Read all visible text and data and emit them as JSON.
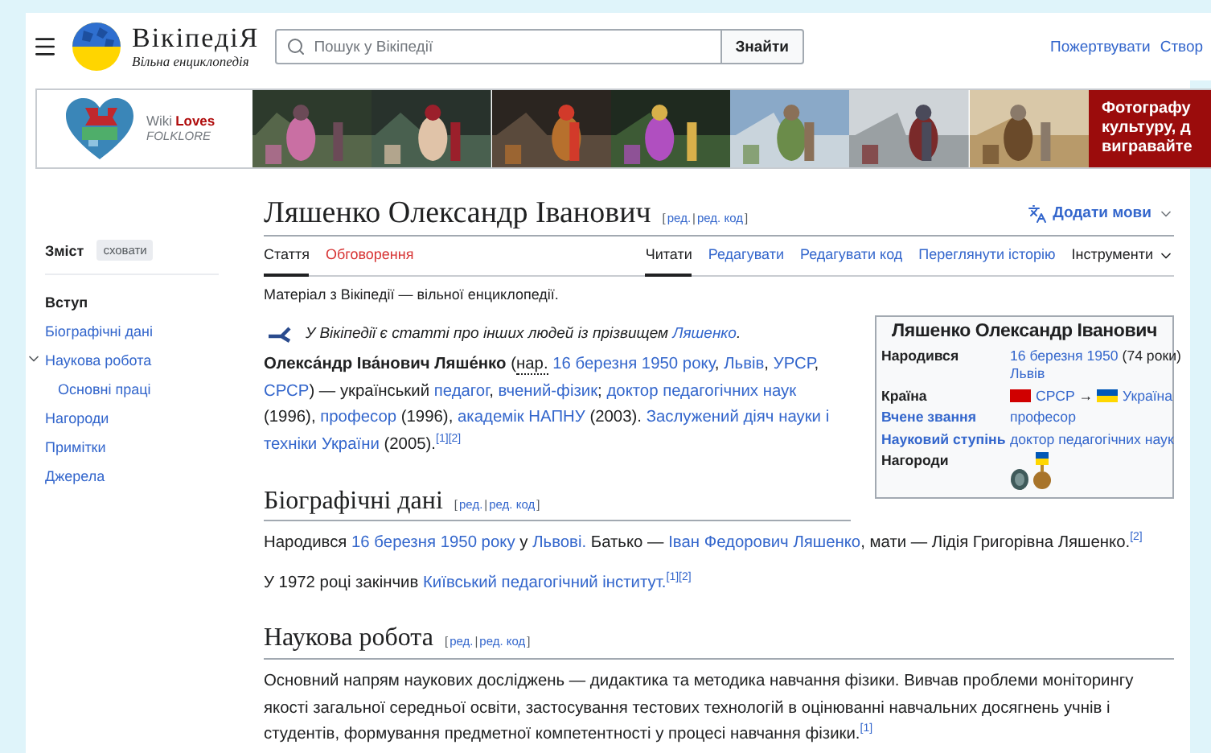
{
  "header": {
    "logo_title": "ВікіпедіЯ",
    "logo_subtitle": "Вільна енциклопедія",
    "search": {
      "placeholder": "Пошук у Вікіпедії",
      "button": "Знайти"
    },
    "links": [
      "Пожертвувати",
      "Створ"
    ]
  },
  "banner": {
    "logo_words": [
      "Wiki",
      "Loves"
    ],
    "logo_sub": "FOLKLORE",
    "photos": [
      {
        "kind": "picture"
      },
      {
        "kind": "picture"
      },
      {
        "kind": "picture"
      },
      {
        "kind": "picture"
      },
      {
        "kind": "picture"
      },
      {
        "kind": "picture"
      },
      {
        "kind": "picture"
      }
    ],
    "promo_lines": [
      "Фотографу",
      "культуру, д",
      "вигравайте"
    ]
  },
  "sidebar": {
    "title": "Зміст",
    "hide_button": "сховати",
    "items": [
      {
        "label": "Вступ",
        "selected": true
      },
      {
        "label": "Біографічні дані",
        "selected": false
      },
      {
        "label": "Наукова робота",
        "selected": false,
        "expanded": true,
        "children": [
          {
            "label": "Основні праці",
            "selected": false
          }
        ]
      },
      {
        "label": "Нагороди",
        "selected": false
      },
      {
        "label": "Примітки",
        "selected": false
      },
      {
        "label": "Джерела",
        "selected": false
      }
    ]
  },
  "article": {
    "title": "Ляшенко Олександр Іванович",
    "title_edit": {
      "open": "[",
      "links": [
        "ред.",
        "ред. код"
      ],
      "separator": "|",
      "close": "]"
    },
    "languages": "Додати мови",
    "tabs_left": [
      {
        "label": "Стаття",
        "selected": true,
        "kind": "page"
      },
      {
        "label": "Обговорення",
        "selected": false,
        "kind": "missing"
      }
    ],
    "tabs_right": [
      {
        "label": "Читати",
        "selected": true,
        "kind": "page"
      },
      {
        "label": "Редагувати",
        "selected": false,
        "kind": "page"
      },
      {
        "label": "Редагувати код",
        "selected": false,
        "kind": "page"
      },
      {
        "label": "Переглянути історію",
        "selected": false,
        "kind": "page"
      },
      {
        "label": "Інструменти",
        "selected": false,
        "kind": "menu"
      }
    ],
    "tagline": "Матеріал з Вікіпедії — вільної енциклопедії.",
    "hatnote": [
      {
        "kind": "text",
        "text": "У Вікіпедії є статті про інших людей із прізвищем "
      },
      {
        "kind": "link",
        "text": "Ляшенко"
      },
      {
        "kind": "text",
        "text": "."
      }
    ],
    "infobox": {
      "title": "Ляшенко Олександр Іванович",
      "rows": [
        {
          "label": {
            "kind": "text",
            "text": "Народився"
          },
          "value": [
            {
              "kind": "link",
              "text": "16 березня 1950"
            },
            {
              "kind": "text",
              "text": " (74 роки)"
            },
            {
              "kind": "break"
            },
            {
              "kind": "link",
              "text": "Львів"
            }
          ]
        },
        {
          "label": {
            "kind": "text",
            "text": "Країна"
          },
          "value": [
            {
              "kind": "sovietflag"
            },
            {
              "kind": "link",
              "text": "СРСР"
            },
            {
              "kind": "text",
              "text": " → "
            },
            {
              "kind": "ukraineflag"
            },
            {
              "kind": "link",
              "text": "Україна"
            }
          ]
        },
        {
          "label": {
            "kind": "link",
            "text": "Вчене звання"
          },
          "value": [
            {
              "kind": "link",
              "text": "професор"
            }
          ]
        },
        {
          "label": {
            "kind": "link",
            "text": "Науковий ступінь"
          },
          "value": [
            {
              "kind": "link",
              "text": "доктор педагогічних наук"
            }
          ]
        },
        {
          "label": {
            "kind": "text",
            "text": "Нагороди"
          },
          "value": [
            {
              "kind": "badge"
            },
            {
              "kind": "medal"
            }
          ]
        }
      ]
    },
    "lead": [
      {
        "kind": "bold",
        "text": "Олекса́ндр Іва́нович Ляше́нко"
      },
      {
        "kind": "text",
        "text": " ("
      },
      {
        "kind": "abbr",
        "text": "нар."
      },
      {
        "kind": "link",
        "text": "16 березня 1950 року"
      },
      {
        "kind": "text",
        "text": ", "
      },
      {
        "kind": "link",
        "text": "Львів"
      },
      {
        "kind": "text",
        "text": ", "
      },
      {
        "kind": "link",
        "text": "УРСР"
      },
      {
        "kind": "text",
        "text": ", "
      },
      {
        "kind": "link",
        "text": "СРСР"
      },
      {
        "kind": "text",
        "text": ") — український "
      },
      {
        "kind": "link",
        "text": "педагог"
      },
      {
        "kind": "text",
        "text": ", "
      },
      {
        "kind": "link",
        "text": "вчений-фізик"
      },
      {
        "kind": "text",
        "text": "; "
      },
      {
        "kind": "link",
        "text": "доктор педагогічних наук"
      },
      {
        "kind": "text",
        "text": " (1996), "
      },
      {
        "kind": "link",
        "text": "професор"
      },
      {
        "kind": "text",
        "text": " (1996), "
      },
      {
        "kind": "link",
        "text": "академік НАПНУ"
      },
      {
        "kind": "text",
        "text": " (2003). "
      },
      {
        "kind": "link",
        "text": "Заслужений діяч науки і"
      },
      {
        "kind": "link",
        "text": "техніки України"
      },
      {
        "kind": "text",
        "text": " (2005)."
      },
      {
        "kind": "ref",
        "text": "[1]"
      },
      {
        "kind": "ref",
        "text": "[2]"
      }
    ],
    "sections": [
      {
        "heading": "Біографічні дані",
        "edit": {
          "open": "[",
          "links": [
            "ред.",
            "ред. код"
          ],
          "separator": "|",
          "close": "]"
        },
        "paragraphs": [
          [
            {
              "kind": "text",
              "text": "Народився "
            },
            {
              "kind": "link",
              "text": "16 березня 1950 року"
            },
            {
              "kind": "text",
              "text": " у "
            },
            {
              "kind": "link",
              "text": "Львові."
            },
            {
              "kind": "text",
              "text": " Батько — "
            },
            {
              "kind": "link",
              "text": "Іван Федорович Ляшенко"
            },
            {
              "kind": "text",
              "text": ", мати — Лідія Григорівна Ляшенко."
            },
            {
              "kind": "ref",
              "text": "[2]"
            }
          ],
          [
            {
              "kind": "text",
              "text": "У 1972 році закінчив "
            },
            {
              "kind": "link",
              "text": "Київський педагогічний інститут."
            },
            {
              "kind": "ref",
              "text": "[1]"
            },
            {
              "kind": "ref",
              "text": "[2]"
            }
          ]
        ]
      },
      {
        "heading": "Наукова робота",
        "edit": {
          "open": "[",
          "links": [
            "ред.",
            "ред. код"
          ],
          "separator": "|",
          "close": "]"
        },
        "paragraphs": [
          [
            {
              "kind": "text",
              "text": "Основний напрям наукових досліджень — дидактика та методика навчання фізики. Вивчав проблеми моніторингу якості загальної середньої освіти, застосування тестових технологій в оцінюванні навчальних досягнень учнів і студентів, формування предметної компетентності у процесі навчання фізики."
            },
            {
              "kind": "ref",
              "text": "[1]"
            }
          ]
        ]
      }
    ]
  }
}
